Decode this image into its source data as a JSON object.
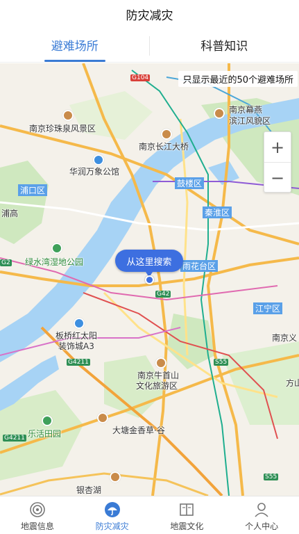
{
  "header": {
    "title": "防灾减灾"
  },
  "tabs": [
    {
      "label": "避难场所",
      "active": true
    },
    {
      "label": "科普知识",
      "active": false
    }
  ],
  "map": {
    "notice": "只显示最近的50个避难场所",
    "search_bubble": "从这里搜索",
    "zoom_in": "+",
    "zoom_out": "−",
    "labels": {
      "l1": "南京珍珠泉风景区",
      "l2": "南京幕燕",
      "l3": "滨江风貌区",
      "l4": "南京长江大桥",
      "l5": "华润万象公馆",
      "l6": "浦口区",
      "l7": "鼓楼区",
      "l8": "秦淮区",
      "l9": "绿水湾湿地公园",
      "l10": "雨花台区",
      "l11": "江宁区",
      "l12": "板桥红太阳",
      "l13": "装饰城A3",
      "l14": "南京牛首山",
      "l15": "文化旅游区",
      "l16": "乐活田园",
      "l17": "大塘金香草·谷",
      "l18": "南京义",
      "l19": "方山",
      "l20": "银杏湖",
      "l21": "浦高"
    },
    "roads": {
      "r1": "G104",
      "r2": "G42",
      "r3": "G4211",
      "r4": "G4211",
      "r5": "S55",
      "r6": "S55",
      "r7": "G2"
    }
  },
  "bottom_nav": [
    {
      "label": "地震信息",
      "icon": "radar-icon",
      "active": false
    },
    {
      "label": "防灾减灾",
      "icon": "umbrella-icon",
      "active": true
    },
    {
      "label": "地震文化",
      "icon": "book-icon",
      "active": false
    },
    {
      "label": "个人中心",
      "icon": "person-icon",
      "active": false
    }
  ],
  "colors": {
    "accent": "#3a7bd5",
    "river": "#8fc3f0",
    "green_area": "#b8e0a8",
    "highway": "#f5b94a"
  }
}
